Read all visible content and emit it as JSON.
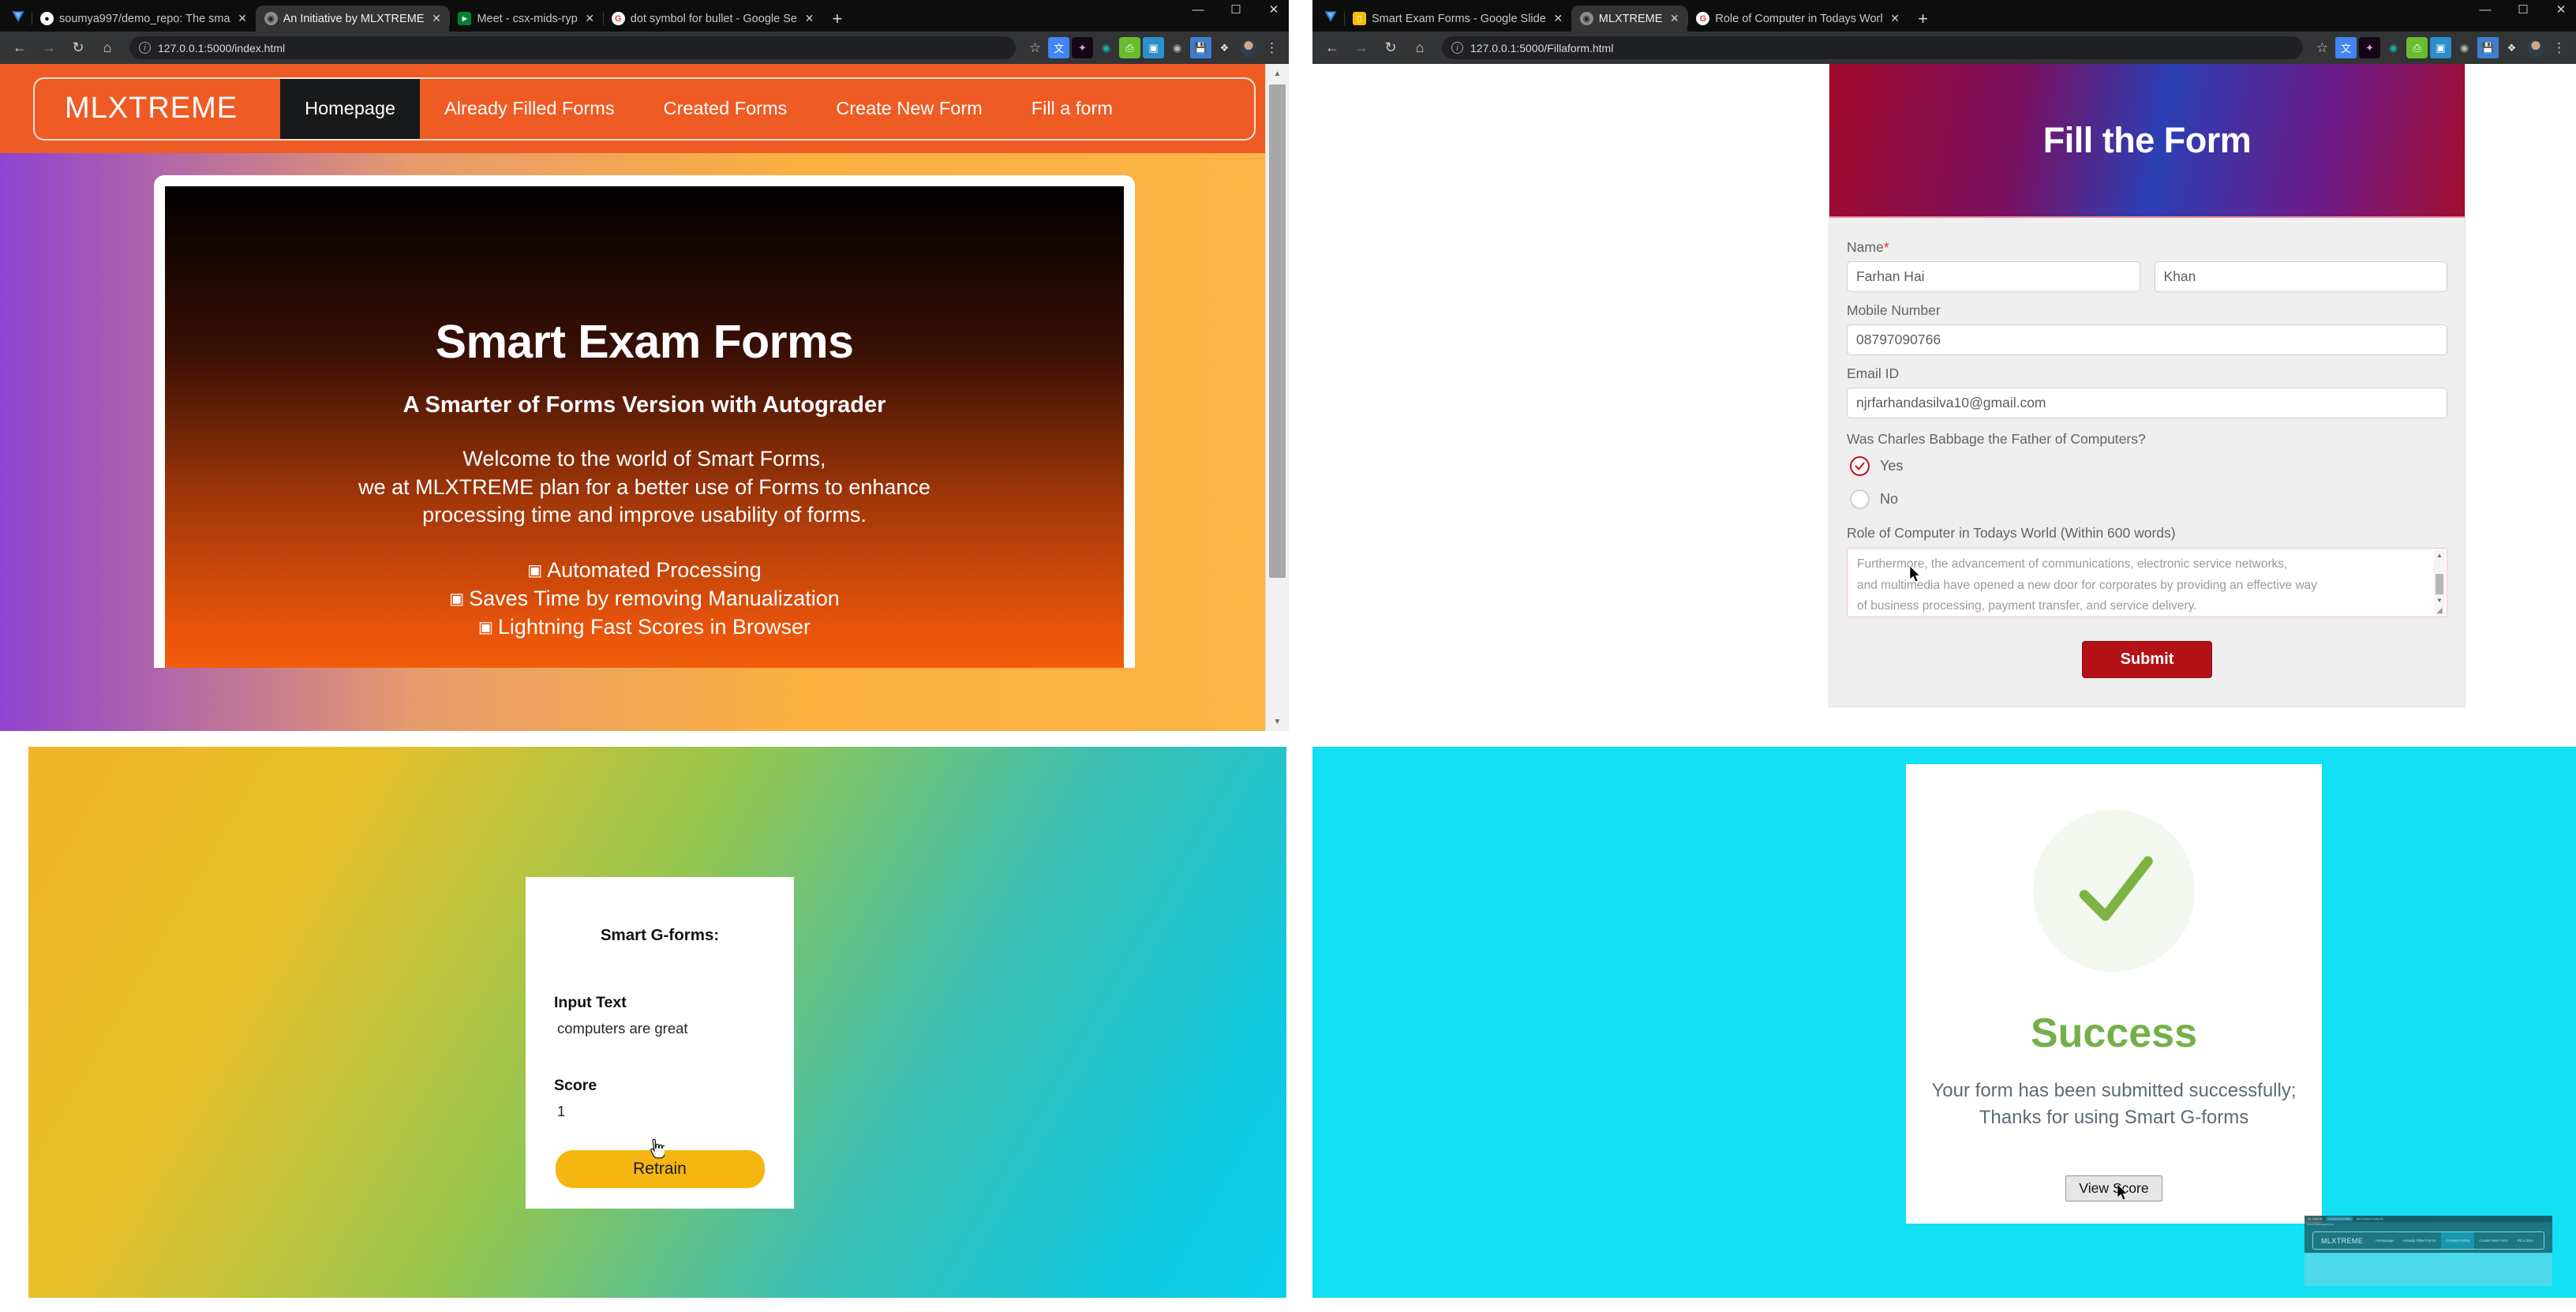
{
  "window_left": {
    "tabs": [
      {
        "title": "soumya997/demo_repo: The sma",
        "favicon": "github-icon",
        "active": false
      },
      {
        "title": "An Initiative by MLXTREME",
        "favicon": "globe-icon",
        "active": true
      },
      {
        "title": "Meet - csx-mids-ryp",
        "favicon": "meet-icon",
        "active": false
      },
      {
        "title": "dot symbol for bullet - Google Se",
        "favicon": "google-icon",
        "active": false
      }
    ],
    "new_tab_label": "+",
    "window_controls": {
      "minimize": "—",
      "maximize": "☐",
      "close": "✕"
    },
    "toolbar": {
      "back": "←",
      "forward": "→",
      "reload": "↻",
      "home": "⌂",
      "url": "127.0.0.1:5000/index.html",
      "star_icon": "bookmark-star-icon",
      "extensions": [
        "translate-icon",
        "paint-icon",
        "circle-icon",
        "print-icon",
        "screencast-icon",
        "camera-icon",
        "save-icon",
        "puzzle-icon"
      ],
      "menu": "⋮"
    },
    "page": {
      "brand": "MLXTREME",
      "nav": [
        {
          "label": "Homepage",
          "active": true
        },
        {
          "label": "Already Filled Forms",
          "active": false
        },
        {
          "label": "Created Forms",
          "active": false
        },
        {
          "label": "Create New Form",
          "active": false
        },
        {
          "label": "Fill a form",
          "active": false
        }
      ],
      "hero": {
        "title": "Smart Exam Forms",
        "subtitle": "A Smarter of Forms Version with Autograder",
        "paragraph_lines": [
          "Welcome to the world of Smart Forms,",
          "we at MLXTREME plan for a better use of Forms to enhance",
          "processing time and improve usability of forms."
        ],
        "bullet_glyph": "▣",
        "bullets": [
          "Automated Processing",
          "Saves Time by removing Manualization",
          "Lightning Fast Scores in Browser"
        ]
      }
    }
  },
  "window_right": {
    "tabs": [
      {
        "title": "Smart Exam Forms - Google Slide",
        "favicon": "slides-icon",
        "active": false
      },
      {
        "title": "MLXTREME",
        "favicon": "globe-icon",
        "active": true
      },
      {
        "title": "Role of Computer in Todays Worl",
        "favicon": "google-icon",
        "active": false
      }
    ],
    "new_tab_label": "+",
    "window_controls": {
      "minimize": "—",
      "maximize": "☐",
      "close": "✕"
    },
    "toolbar": {
      "back": "←",
      "forward": "→",
      "reload": "↻",
      "home": "⌂",
      "url": "127.0.0.1:5000/Fillaform.html",
      "star_icon": "bookmark-star-icon",
      "extensions": [
        "translate-icon",
        "paint-icon",
        "circle-icon",
        "print-icon",
        "screencast-icon",
        "camera-icon",
        "save-icon",
        "puzzle-icon"
      ],
      "menu": "⋮"
    },
    "form": {
      "banner_title": "Fill the Form",
      "name_label": "Name",
      "required_mark": "*",
      "first_name_value": "Farhan Hai",
      "last_name_value": "Khan",
      "mobile_label": "Mobile Number",
      "mobile_value": "08797090766",
      "email_label": "Email ID",
      "email_value": "njrfarhandasilva10@gmail.com",
      "question_label": "Was Charles Babbage the Father of Computers?",
      "options": [
        {
          "label": "Yes",
          "selected": true
        },
        {
          "label": "No",
          "selected": false
        }
      ],
      "essay_label": "Role of Computer in Todays World (Within 600 words)",
      "essay_lines": [
        "Furthermore, the advancement of communications, electronic service networks,",
        "and multimedia have opened a new door for corporates by providing an effective way",
        "of business processing, payment transfer, and service delivery."
      ],
      "submit_label": "Submit"
    }
  },
  "panel_score": {
    "title": "Smart G-forms:",
    "input_text_label": "Input Text",
    "input_text_value": "computers are great",
    "score_label": "Score",
    "score_value": "1",
    "retrain_label": "Retrain"
  },
  "panel_success": {
    "check_icon": "check-mark-icon",
    "heading": "Success",
    "message_lines": [
      "Your form has been submitted successfully;",
      "Thanks for using Smart G-forms"
    ],
    "view_score_label": "View Score"
  },
  "thumbnail_overlay": {
    "tabs": [
      {
        "title": "rms - Google Slid",
        "active": false
      },
      {
        "title": "An Initiative by MLXTREME",
        "active": true
      },
      {
        "title": "Role of Computer in Todays Wo",
        "active": false
      }
    ],
    "url": "127.0.0.1:5000/createdforms.html",
    "brand": "MLXTREME",
    "nav": [
      {
        "label": "Homepage",
        "active": false
      },
      {
        "label": "Already Filled Forms",
        "active": false
      },
      {
        "label": "Created Forms",
        "active": true
      },
      {
        "label": "Create New Form",
        "active": false
      },
      {
        "label": "Fill a form",
        "active": false
      }
    ]
  },
  "colors": {
    "orange_nav": "#ef5b24",
    "nav_active": "#17191a",
    "submit_red": "#b31217",
    "retrain_yellow": "#f5b612",
    "success_green": "#74b04a",
    "cyan_bg": "#13dff5",
    "radio_selected": "#c1121f"
  }
}
